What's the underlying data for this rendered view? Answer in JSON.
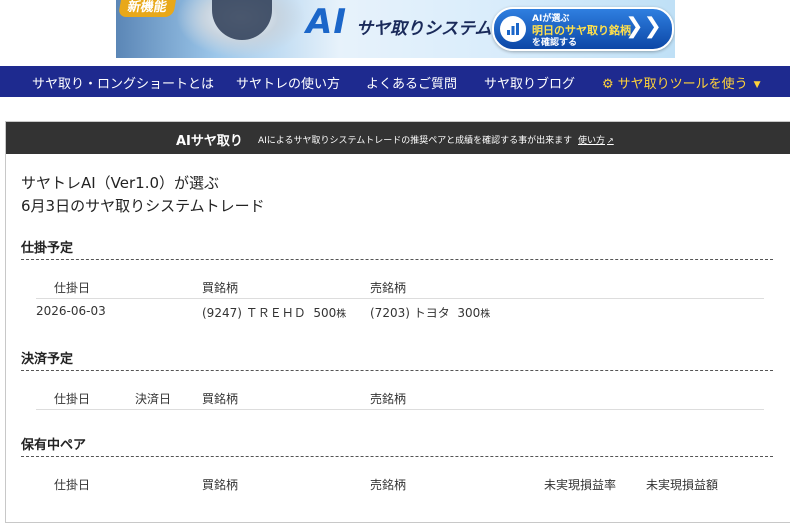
{
  "banner": {
    "badge": "新機能",
    "ai": "AI",
    "title": "サヤ取りシステムトレード",
    "cta_line1": "AIが選ぶ",
    "cta_line2": "明日のサヤ取り銘柄",
    "cta_line3": "を確認する",
    "cta_arrows": "❯❯"
  },
  "nav": {
    "items": [
      {
        "label": "サヤ取り・ロングショートとは"
      },
      {
        "label": "サヤトレの使い方"
      },
      {
        "label": "よくあるご質問"
      },
      {
        "label": "サヤ取りブログ"
      }
    ],
    "tool_label": "サヤ取りツールを使う",
    "tool_caret": "▼",
    "tool_gear": "⚙"
  },
  "panel": {
    "title": "AIサヤ取り",
    "description": "AIによるサヤ取りシステムトレードの推奨ペアと成績を確認する事が出来ます",
    "link": "使い方",
    "link_icon": "↗",
    "intro_line1": "サヤトレAI（Ver1.0）が選ぶ",
    "intro_line2": "6月3日のサヤ取りシステムトレード"
  },
  "sections": {
    "planned_entry": {
      "title": "仕掛予定",
      "columns": [
        "仕掛日",
        "買銘柄",
        "売銘柄"
      ],
      "rows": [
        {
          "date": "2026-06-03",
          "buy": "(9247) ＴＲＥＨＤ",
          "buy_qty": "500",
          "sell": "(7203) トヨタ",
          "sell_qty": "300",
          "unit": "株"
        }
      ]
    },
    "planned_exit": {
      "title": "決済予定",
      "columns": [
        "仕掛日",
        "決済日",
        "買銘柄",
        "売銘柄"
      ]
    },
    "holding": {
      "title": "保有中ペア",
      "columns": [
        "仕掛日",
        "買銘柄",
        "売銘柄",
        "未実現損益率",
        "未実現損益額"
      ]
    }
  }
}
